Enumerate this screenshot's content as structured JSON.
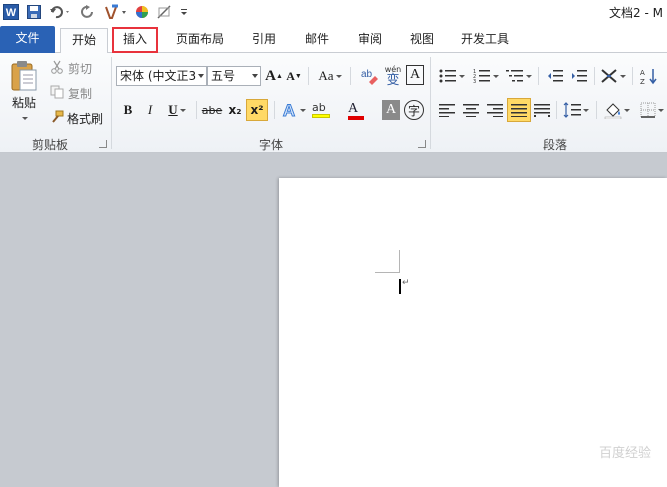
{
  "window": {
    "title": "文档2 - M"
  },
  "quick_access": {
    "icons": [
      "word-logo-icon",
      "save-icon",
      "undo-icon",
      "redo-icon",
      "format-painter-icon",
      "color-circle-icon",
      "draw-icon",
      "customize-icon"
    ]
  },
  "tabs": {
    "file": "文件",
    "home": "开始",
    "insert": "插入",
    "layout": "页面布局",
    "references": "引用",
    "mailings": "邮件",
    "review": "审阅",
    "view": "视图",
    "developer": "开发工具"
  },
  "clipboard": {
    "label": "剪贴板",
    "paste": "粘贴",
    "cut": "剪切",
    "copy": "复制",
    "format_painter": "格式刷"
  },
  "font": {
    "label": "字体",
    "font_name": "宋体 (中文正3",
    "font_size": "五号",
    "change_case": "Aa",
    "wen_label": "wén",
    "wen_char": "变",
    "border_char": "A",
    "bold": "B",
    "italic": "I",
    "underline": "U",
    "strikethrough": "abe",
    "subscript": "x₂",
    "superscript": "x²",
    "highlight": "ab",
    "font_color": "A",
    "char_shading": "A",
    "enclose_char": "字"
  },
  "paragraph": {
    "label": "段落"
  },
  "colors": {
    "file_tab": "#2a62b5",
    "insert_highlight": "#e8323c",
    "font_color_bar": "#e00000",
    "highlight_bar": "#ffff00",
    "justify_active": "#ffd966"
  },
  "watermark": "百度经验"
}
